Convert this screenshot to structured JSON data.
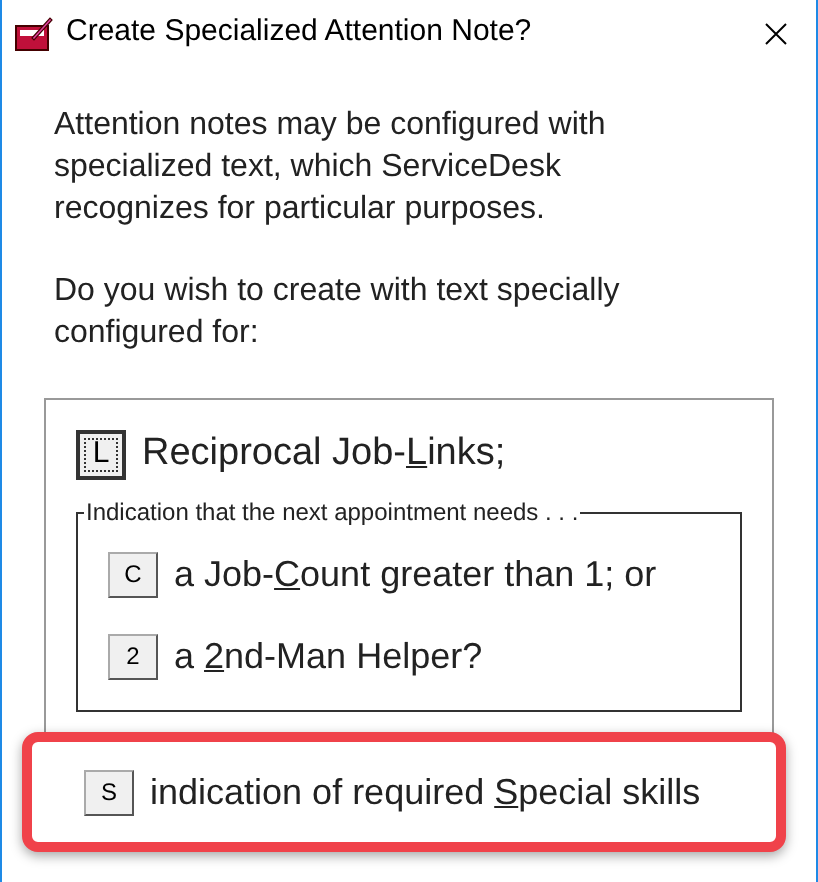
{
  "window": {
    "title": "Create Specialized Attention Note?"
  },
  "paragraphs": [
    "Attention notes may be configured with specialized text, which ServiceDesk recognizes for particular purposes.",
    "Do you wish to create with text specially configured for:"
  ],
  "options": [
    {
      "key": "L",
      "before": "Reciprocal Job-",
      "underlined": "L",
      "after": "inks;",
      "focused": true
    }
  ],
  "group": {
    "caption": "Indication that the next appointment needs . . .",
    "options": [
      {
        "key": "C",
        "before": "a Job-",
        "underlined": "C",
        "after": "ount greater than 1; or",
        "focused": false
      },
      {
        "key": "2",
        "before": "a ",
        "underlined": "2",
        "after": "nd-Man Helper?",
        "focused": false
      }
    ]
  },
  "last_option": {
    "key": "S",
    "before": "indication of required ",
    "underlined": "S",
    "after": "pecial skills",
    "focused": false,
    "highlighted": true
  }
}
